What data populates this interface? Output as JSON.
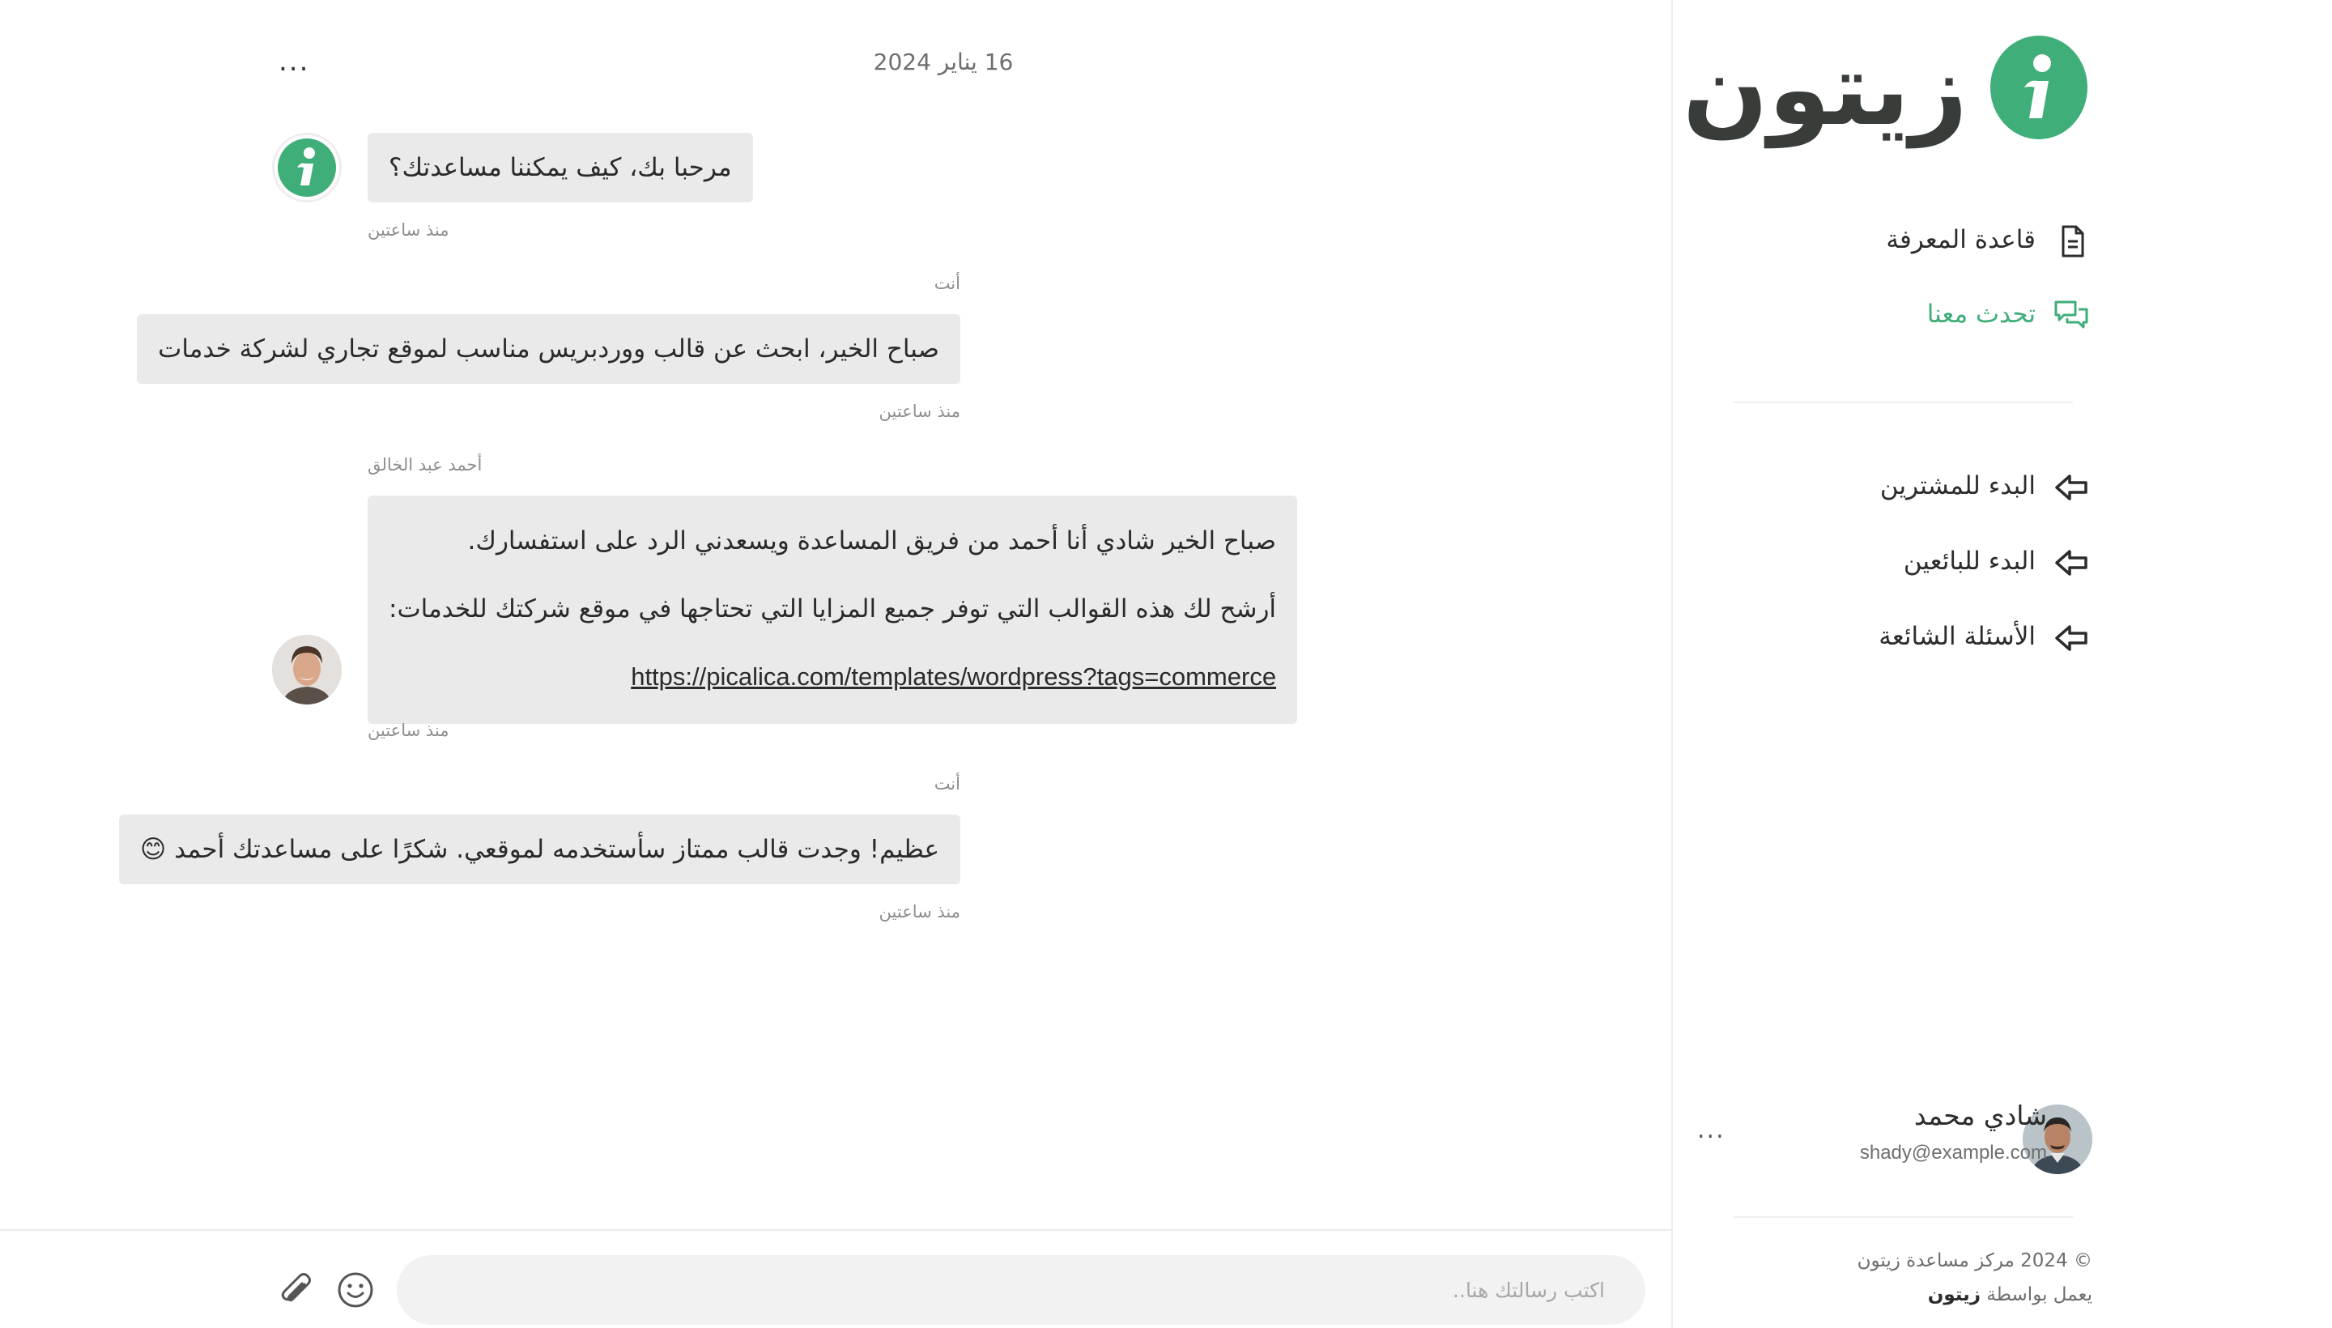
{
  "brand": {
    "logo_text": "زيتون",
    "accent_color": "#3fae79"
  },
  "sidebar": {
    "nav_primary": [
      {
        "label": "قاعدة المعرفة",
        "icon": "document-icon",
        "active": false
      },
      {
        "label": "تحدث معنا",
        "icon": "chat-bubbles-icon",
        "active": true
      }
    ],
    "nav_secondary": [
      {
        "label": "البدء للمشترين",
        "icon": "arrow-left-icon"
      },
      {
        "label": "البدء للبائعين",
        "icon": "arrow-left-icon"
      },
      {
        "label": "الأسئلة الشائعة",
        "icon": "arrow-left-icon"
      }
    ],
    "user": {
      "name": "شادي محمد",
      "email": "shady@example.com",
      "menu": "..."
    },
    "footer": {
      "copyright": "© 2024 مركز مساعدة زيتون",
      "powered_prefix": "يعمل بواسطة",
      "powered_brand": "زيتون"
    }
  },
  "chat": {
    "date": "16 يناير 2024",
    "menu": "...",
    "messages": [
      {
        "from": "bot",
        "lines": [
          "مرحبا بك، كيف يمكننا مساعدتك؟"
        ],
        "time": "منذ ساعتين"
      },
      {
        "from": "user",
        "sender": "أنت",
        "lines": [
          "صباح الخير، ابحث عن قالب ووردبريس مناسب لموقع تجاري لشركة خدمات"
        ],
        "time": "منذ ساعتين"
      },
      {
        "from": "agent",
        "sender": "أحمد عبد الخالق",
        "lines": [
          "صباح الخير شادي أنا أحمد من فريق المساعدة ويسعدني الرد على استفسارك.",
          "أرشح لك هذه القوالب التي توفر جميع المزايا التي تحتاجها في موقع شركتك للخدمات:"
        ],
        "link": "https://picalica.com/templates/wordpress?tags=commerce",
        "time": "منذ ساعتين"
      },
      {
        "from": "user",
        "sender": "أنت",
        "lines": [
          "عظيم! وجدت قالب ممتاز سأستخدمه لموقعي. شكرًا على مساعدتك أحمد 😊"
        ],
        "time": "منذ ساعتين"
      }
    ]
  },
  "composer": {
    "placeholder": "اكتب رسالتك هنا..",
    "value": ""
  }
}
